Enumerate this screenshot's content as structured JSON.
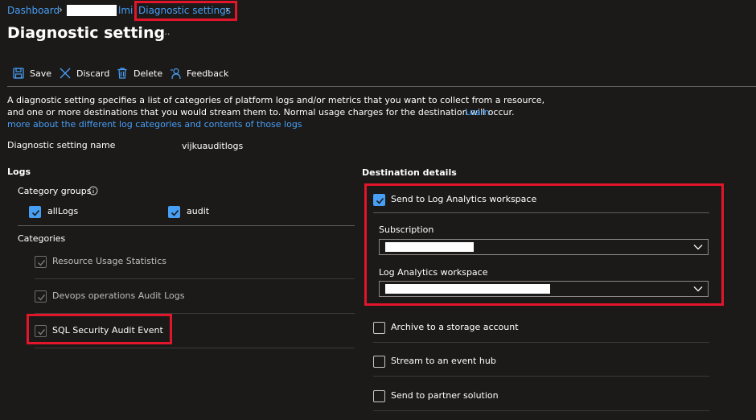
{
  "breadcrumb": {
    "dashboard": "Dashboard",
    "resource_suffix": "lmi",
    "diagnostic_settings": "Diagnostic settings"
  },
  "page": {
    "title": "Diagnostic setting",
    "more": "···"
  },
  "toolbar": {
    "save": "Save",
    "discard": "Discard",
    "delete": "Delete",
    "feedback": "Feedback"
  },
  "description": {
    "line1": "A diagnostic setting specifies a list of categories of platform logs and/or metrics that you want to collect from a resource,",
    "line2": "and one or more destinations that you would stream them to. Normal usage charges for the destination will occur.",
    "learn": "Learn",
    "line3": "more about the different log categories and contents of those logs"
  },
  "setting_name": {
    "label": "Diagnostic setting name",
    "value": "vijkuauditlogs"
  },
  "logs": {
    "heading": "Logs",
    "category_groups_label": "Category groups",
    "groups": [
      {
        "label": "allLogs",
        "checked": true
      },
      {
        "label": "audit",
        "checked": true
      }
    ],
    "categories_label": "Categories",
    "categories": [
      {
        "label": "Resource Usage Statistics",
        "checked": true,
        "disabled": true
      },
      {
        "label": "Devops operations Audit Logs",
        "checked": true,
        "disabled": true
      },
      {
        "label": "SQL Security Audit Event",
        "checked": true,
        "disabled": true
      }
    ]
  },
  "destination": {
    "heading": "Destination details",
    "log_analytics": {
      "label": "Send to Log Analytics workspace",
      "checked": true
    },
    "subscription_label": "Subscription",
    "workspace_label": "Log Analytics workspace",
    "archive": {
      "label": "Archive to a storage account",
      "checked": false
    },
    "event_hub": {
      "label": "Stream to an event hub",
      "checked": false
    },
    "partner": {
      "label": "Send to partner solution",
      "checked": false
    }
  },
  "colors": {
    "background": "#1b1a19",
    "accent": "#479ef5",
    "highlight": "#e3152b"
  }
}
